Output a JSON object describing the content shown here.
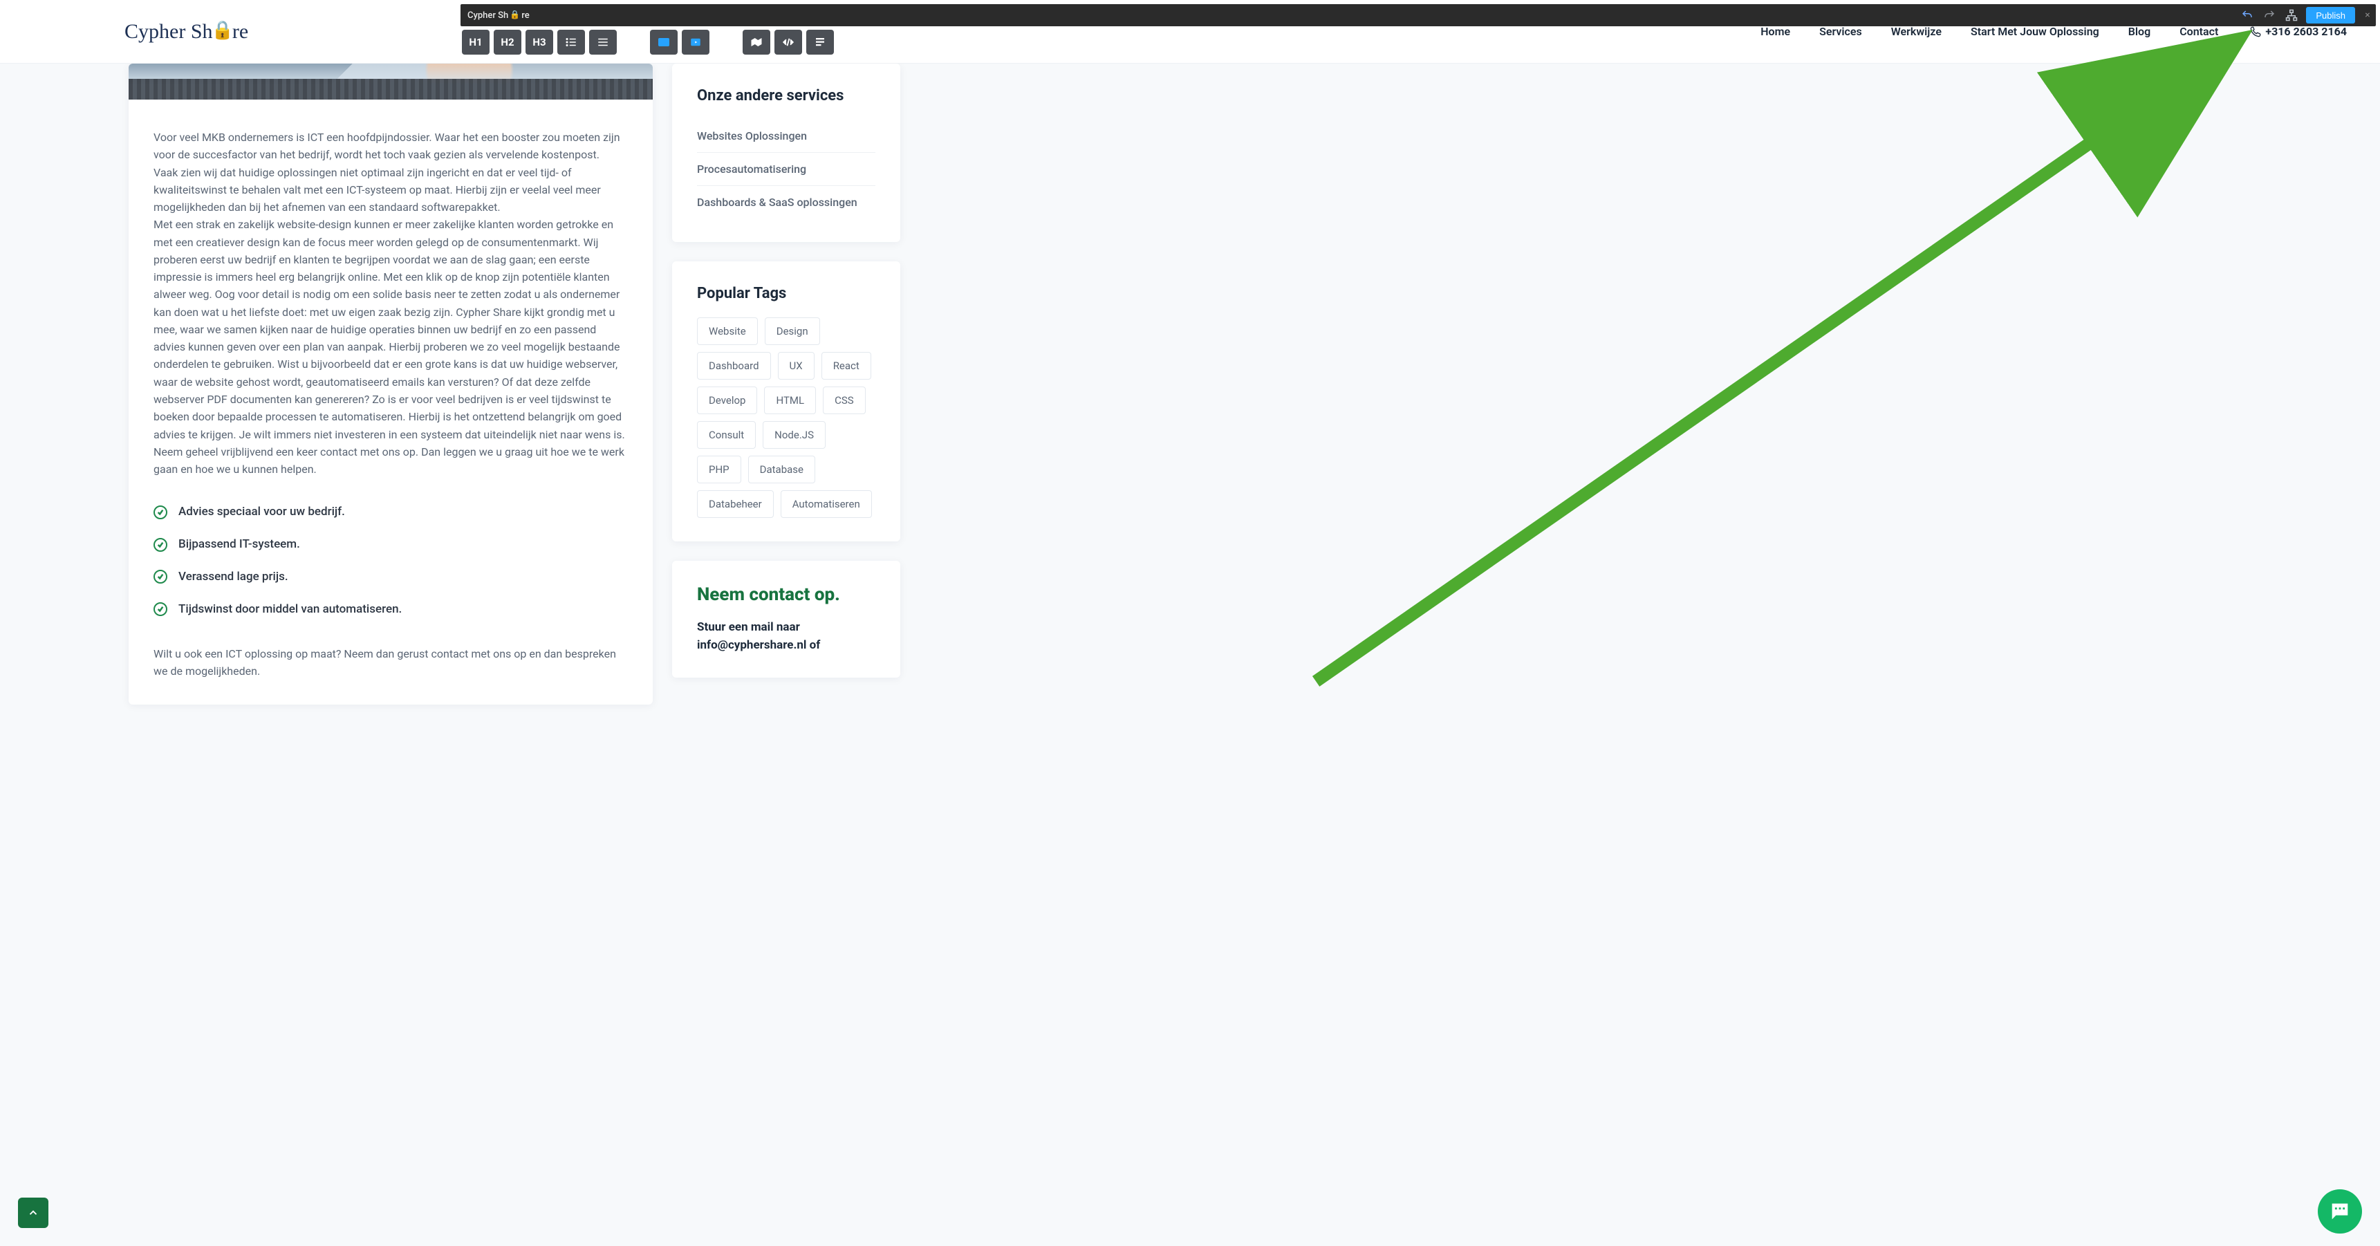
{
  "editor": {
    "brand": "Cypher Sh",
    "brand2": "re",
    "publish_label": "Publish"
  },
  "toolbar": {
    "h1": "H1",
    "h2": "H2",
    "h3": "H3"
  },
  "site": {
    "logo_a": "Cypher Sh",
    "logo_b": "re",
    "phone": "+316 2603 2164"
  },
  "nav": {
    "items": [
      {
        "label": "Home"
      },
      {
        "label": "Services"
      },
      {
        "label": "Werkwijze"
      },
      {
        "label": "Start Met Jouw Oplossing"
      },
      {
        "label": "Blog"
      },
      {
        "label": "Contact"
      }
    ]
  },
  "article": {
    "p1": "Voor veel MKB ondernemers is ICT een hoofdpijndossier. Waar het een booster zou moeten zijn voor de succesfactor van het bedrijf, wordt het toch vaak gezien als vervelende kostenpost.",
    "p2": "Vaak zien wij dat huidige oplossingen niet optimaal zijn ingericht en dat er veel tijd- of kwaliteitswinst te behalen valt met een ICT-systeem op maat. Hierbij zijn er veelal veel meer mogelijkheden dan bij het afnemen van een standaard softwarepakket.",
    "p3": "Met een strak en zakelijk website-design kunnen er meer zakelijke klanten worden getrokke en met een creatiever design kan de focus meer worden gelegd op de consumentenmarkt. Wij proberen eerst uw bedrijf en klanten te begrijpen voordat we aan de slag gaan; een eerste impressie is immers heel erg belangrijk online. Met een klik op de knop zijn potentiële klanten alweer weg. Oog voor detail is nodig om een solide basis neer te zetten zodat u als ondernemer kan doen wat u het liefste doet: met uw eigen zaak bezig zijn. Cypher Share kijkt grondig met u mee, waar we samen kijken naar de huidige operaties binnen uw bedrijf en zo een passend advies kunnen geven over een plan van aanpak. Hierbij proberen we zo veel mogelijk bestaande onderdelen te gebruiken. Wist u bijvoorbeeld dat er een grote kans is dat uw huidige webserver, waar de website gehost wordt, geautomatiseerd emails kan versturen? Of dat deze zelfde webserver PDF documenten kan genereren? Zo is er voor veel bedrijven is er veel tijdswinst te boeken door bepaalde processen te automatiseren. Hierbij is het ontzettend belangrijk om goed advies te krijgen. Je wilt immers niet investeren in een systeem dat uiteindelijk niet naar wens is.",
    "p4": "Neem geheel vrijblijvend een keer contact met ons op. Dan leggen we u graag uit hoe we te werk gaan en hoe we u kunnen helpen.",
    "bullets": [
      "Advies speciaal voor uw bedrijf.",
      "Bijpassend IT-systeem.",
      "Verassend lage prijs.",
      "Tijdswinst door middel van automatiseren."
    ],
    "p5": "Wilt u ook een ICT oplossing op maat? Neem dan gerust contact met ons op en dan bespreken we de mogelijkheden."
  },
  "sidebar": {
    "services_title": "Onze andere services",
    "services": [
      "Websites Oplossingen",
      "Procesautomatisering",
      "Dashboards & SaaS oplossingen"
    ],
    "tags_title": "Popular Tags",
    "tags": [
      "Website",
      "Design",
      "Dashboard",
      "UX",
      "React",
      "Develop",
      "HTML",
      "CSS",
      "Consult",
      "Node.JS",
      "PHP",
      "Database",
      "Databeheer",
      "Automatiseren"
    ],
    "contact_title": "Neem contact op.",
    "contact_line": "Stuur een mail naar info@cyphershare.nl of"
  }
}
